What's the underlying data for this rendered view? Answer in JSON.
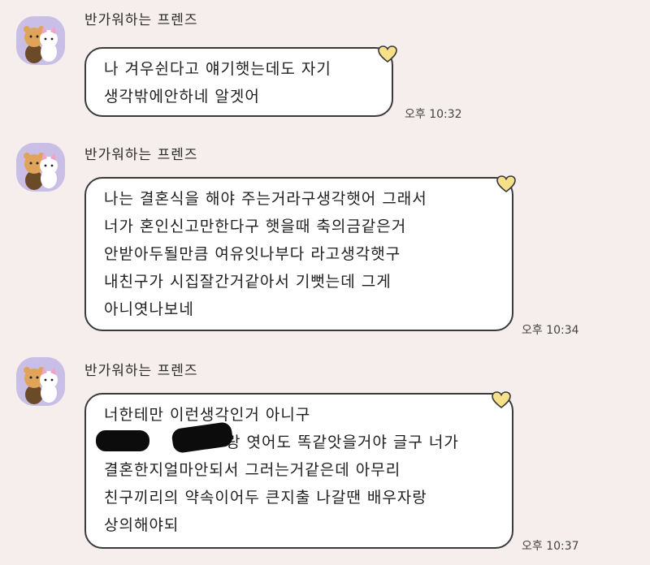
{
  "messages": [
    {
      "sender": "반가워하는 프렌즈",
      "lines": [
        "나 겨우쉰다고 얘기햇는데도 자기",
        "생각밖에안하네 알겟어"
      ],
      "time": "오후 10:32"
    },
    {
      "sender": "반가워하는 프렌즈",
      "lines": [
        "나는 결혼식을 해야 주는거라구생각햇어 그래서",
        "너가 혼인신고만한다구 햇을때 축의금같은거",
        "안받아두될만큼 여유잇나부다 라고생각햇구",
        "내친구가 시집잘간거같아서 기뻣는데 그게",
        "아니엿나보네"
      ],
      "time": "오후 10:34"
    },
    {
      "sender": "반가워하는 프렌즈",
      "lines": [
        "너한테만 이런생각인거 아니구",
        "랑 엿어도 똑같앗을거야 글구 너가",
        "결혼한지얼마안되서 그러는거같은데 아무리",
        "친구끼리의 약속이어두 큰지출 나갈땐 배우자랑",
        "상의해야되"
      ],
      "time": "오후 10:37"
    }
  ],
  "colors": {
    "background": "#f5eeec",
    "avatar_bg": "#c9bee6",
    "bubble_border": "#3a3a3a",
    "heart": "#f6e08a"
  },
  "icons": {
    "avatar": "friends-avatar-icon",
    "heart": "heart-icon"
  }
}
